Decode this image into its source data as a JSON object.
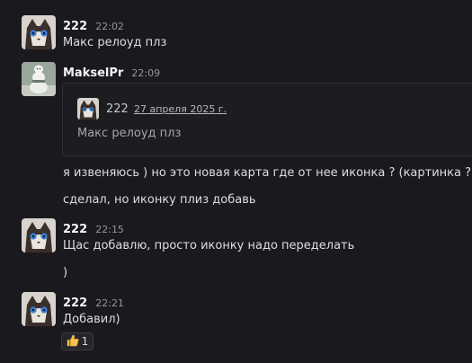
{
  "messages": [
    {
      "user": "222",
      "time": "22:02",
      "lines": [
        "Макс релоуд плз"
      ]
    },
    {
      "user": "MakselPr",
      "time": "22:09",
      "embed": {
        "user": "222",
        "date": "27 апреля 2025 г.",
        "text": "Макс релоуд плз"
      },
      "lines": [
        "я извеняюсь ) но это новая карта где от нее иконка ? (картинка ?)",
        "сделал, но иконку плиз добавь"
      ]
    },
    {
      "user": "222",
      "time": "22:15",
      "lines": [
        "Щас добавлю, просто иконку надо переделать",
        ")"
      ]
    },
    {
      "user": "222",
      "time": "22:21",
      "lines": [
        "Добавил)"
      ],
      "reaction": {
        "emoji": "thumbs-up-icon",
        "count": "1"
      }
    }
  ],
  "colors": {
    "background": "#1a1a1e",
    "text": "#dbdee1",
    "muted": "#94969c"
  }
}
